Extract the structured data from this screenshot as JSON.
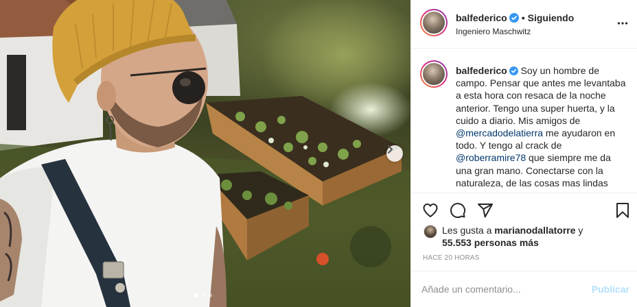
{
  "post": {
    "username": "balfederico",
    "follow_status": "Siguiendo",
    "separator": "•",
    "location": "Ingeniero Maschwitz",
    "caption": {
      "username": "balfederico",
      "text_part1": "Soy un hombre de campo. Pensar que antes me levantaba a esta hora con resaca de la noche anterior. Tengo una super huerta, y la cuido a diario. Mis amigos de ",
      "mention1": "@mercadodelatierra",
      "text_part2": " me ayudaron en todo. Y tengo al crack de ",
      "mention2": "@roberramire78",
      "text_part3": " que siempre me da una gran mano. Conectarse con la naturaleza, de las cosas mas lindas"
    },
    "likes": {
      "prefix": "Les gusta a ",
      "user": "marianodallatorre",
      "connector": " y",
      "count": "55.553 personas más"
    },
    "timestamp": "HACE 20 HORAS",
    "comment_placeholder": "Añade un comentario...",
    "publish_label": "Publicar",
    "carousel": {
      "total": 3,
      "active_index": 0
    }
  },
  "icons": {
    "verified": "verified-badge-icon",
    "more": "more-options-icon",
    "like": "heart-icon",
    "comment": "comment-icon",
    "share": "share-icon",
    "save": "bookmark-icon",
    "next": "chevron-right-icon"
  },
  "colors": {
    "text": "#262626",
    "secondary": "#8e8e8e",
    "link": "#00376b",
    "verified": "#3897f0",
    "publish_disabled": "#b2dffc",
    "border": "#efefef"
  }
}
